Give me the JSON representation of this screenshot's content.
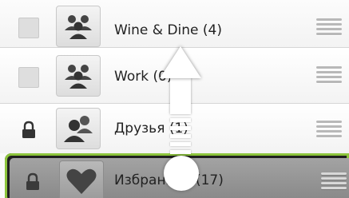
{
  "groups": [
    {
      "lead": "checkbox",
      "avatar_icon": "group-people-icon",
      "label": "Wine & Dine (4)"
    },
    {
      "lead": "checkbox",
      "avatar_icon": "group-people-icon",
      "label": "Work (0)"
    },
    {
      "lead": "lock-icon",
      "avatar_icon": "friends-people-icon",
      "label": "Друзья (1)"
    }
  ],
  "dragging": {
    "lead": "lock-icon",
    "avatar_icon": "heart-icon",
    "label": "Избранное (17)"
  },
  "gesture": {
    "direction": "up",
    "icon": "drag-up-arrow-icon"
  },
  "colors": {
    "accent": "#8cc43c"
  }
}
